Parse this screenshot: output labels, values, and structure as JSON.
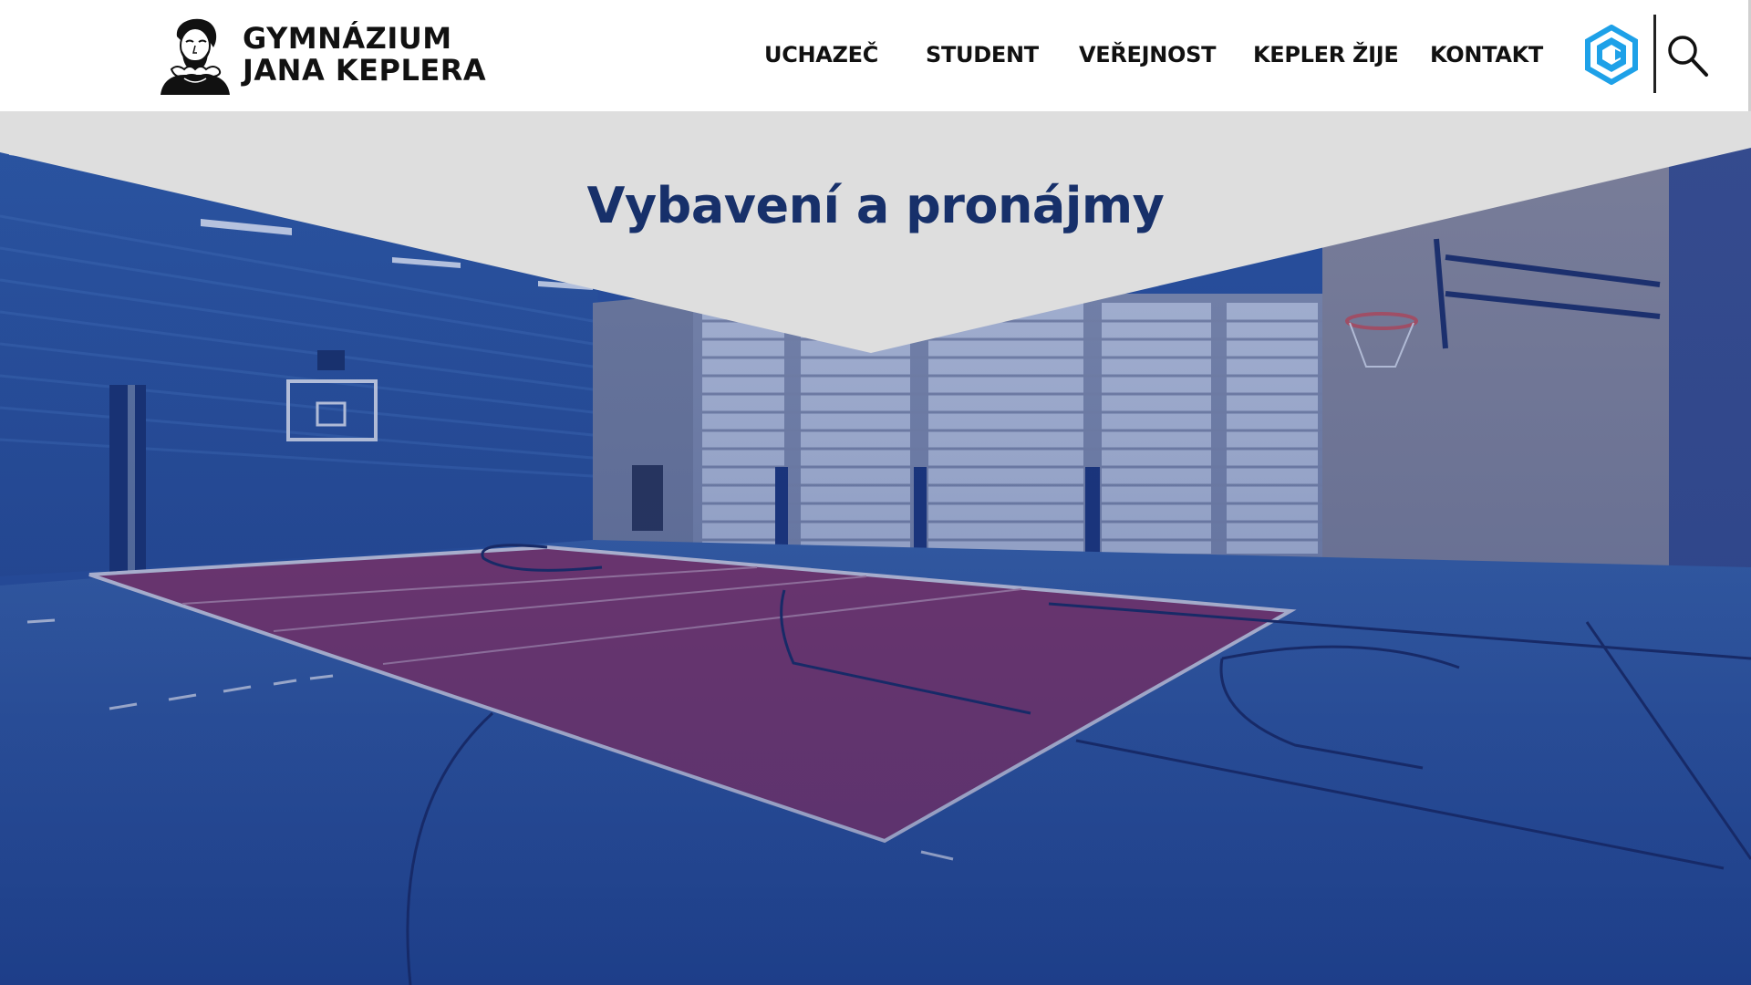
{
  "header": {
    "logo": {
      "line1": "GYMNÁZIUM",
      "line2": "JANA KEPLERA",
      "portrait_icon": "kepler-portrait-icon"
    },
    "nav": [
      {
        "label": "UCHAZEČ"
      },
      {
        "label": "STUDENT"
      },
      {
        "label": "VEŘEJNOST"
      },
      {
        "label": "KEPLER ŽIJE"
      },
      {
        "label": "KONTAKT"
      }
    ],
    "brand_icon": "hexagon-logo-icon",
    "search_icon": "search-icon"
  },
  "hero": {
    "title": "Vybavení a pronájmy",
    "image_subject": "sports-hall-photo"
  },
  "colors": {
    "title": "#17306a",
    "brand_accent": "#1ea1e8",
    "overlay": "#1f3a8a",
    "banner": "#dedede"
  }
}
